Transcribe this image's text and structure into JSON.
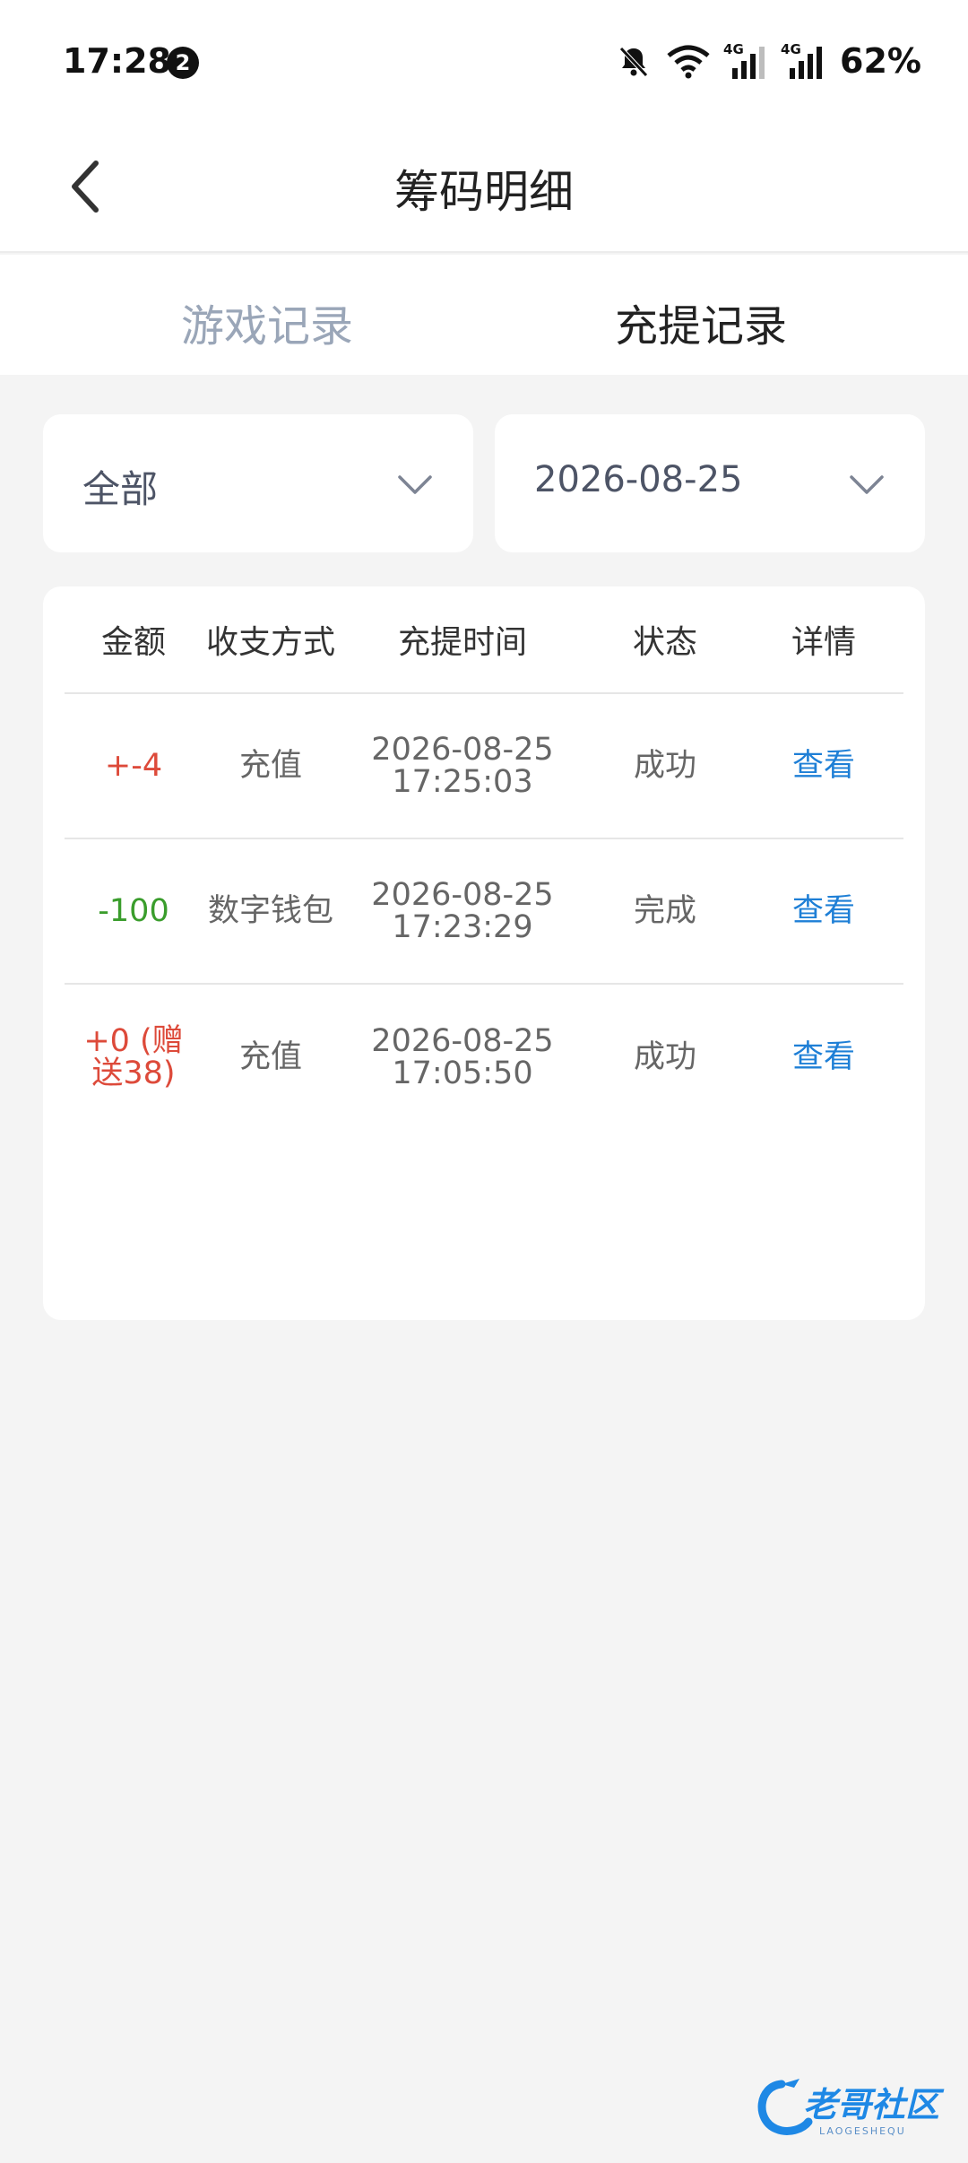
{
  "status_bar": {
    "time": "17:28",
    "notification_count": "2",
    "network_1": "4G",
    "network_2": "4G",
    "battery": "62%"
  },
  "header": {
    "title": "筹码明细"
  },
  "tabs": [
    {
      "label": "游戏记录",
      "active": false
    },
    {
      "label": "充提记录",
      "active": true
    }
  ],
  "filters": {
    "type": "全部",
    "date": "2026-08-25"
  },
  "table": {
    "columns": [
      "金额",
      "收支方式",
      "充提时间",
      "状态",
      "详情"
    ],
    "rows": [
      {
        "amount": "+-4",
        "method": "充值",
        "date": "2026-08-25",
        "time": "17:25:03",
        "status": "成功",
        "detail": "查看"
      },
      {
        "amount": "-100",
        "method": "数字钱包",
        "date": "2026-08-25",
        "time": "17:23:29",
        "status": "完成",
        "detail": "查看"
      },
      {
        "amount_line1": "+0 (赠",
        "amount_line2": "送38)",
        "method": "充值",
        "date": "2026-08-25",
        "time": "17:05:50",
        "status": "成功",
        "detail": "查看"
      }
    ]
  },
  "watermark": {
    "text": "老哥社区",
    "subtext": "LAOGESHEQU"
  },
  "colors": {
    "positive_amount": "#dd4a3a",
    "negative_amount": "#3a9d2c",
    "link": "#1e7fd6",
    "inactive_tab": "#9aa6b8"
  }
}
